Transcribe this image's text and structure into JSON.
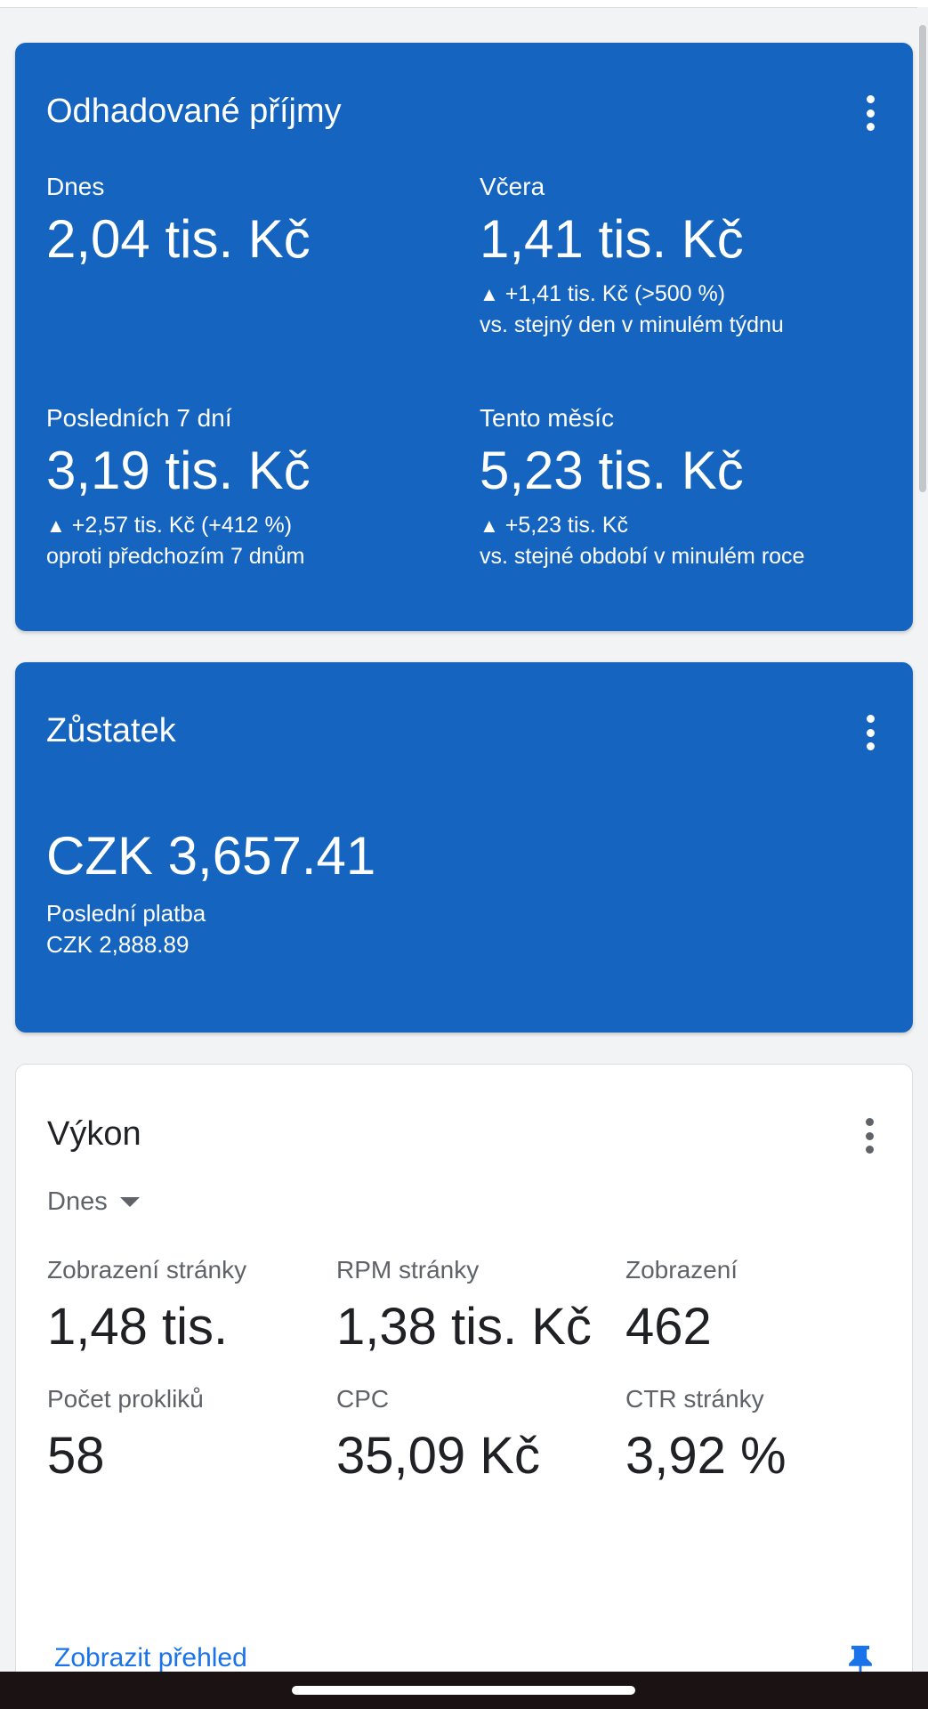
{
  "earnings": {
    "title": "Odhadované příjmy",
    "today": {
      "label": "Dnes",
      "value": "2,04 tis. Kč"
    },
    "yesterday": {
      "label": "Včera",
      "value": "1,41 tis. Kč",
      "delta": "+1,41 tis. Kč (>500 %)",
      "compare": "vs. stejný den v minulém týdnu"
    },
    "last7": {
      "label": "Posledních 7 dní",
      "value": "3,19 tis. Kč",
      "delta": "+2,57 tis. Kč (+412 %)",
      "compare": "oproti předchozím 7 dnům"
    },
    "month": {
      "label": "Tento měsíc",
      "value": "5,23 tis. Kč",
      "delta": "+5,23 tis. Kč",
      "compare": "vs. stejné období v minulém roce"
    },
    "up_glyph": "▲"
  },
  "balance": {
    "title": "Zůstatek",
    "value": "CZK 3,657.41",
    "last_payment_label": "Poslední platba",
    "last_payment_value": "CZK 2,888.89"
  },
  "performance": {
    "title": "Výkon",
    "period": "Dnes",
    "metrics": [
      {
        "label": "Zobrazení stránky",
        "value": "1,48 tis."
      },
      {
        "label": "RPM stránky",
        "value": "1,38 tis. Kč"
      },
      {
        "label": "Zobrazení",
        "value": "462"
      },
      {
        "label": "Počet prokliků",
        "value": "58"
      },
      {
        "label": "CPC",
        "value": "35,09 Kč"
      },
      {
        "label": "CTR stránky",
        "value": "3,92 %"
      }
    ],
    "link": "Zobrazit přehled"
  },
  "icons": {
    "more": "more-vert-icon",
    "dropdown": "arrow-drop-down-icon",
    "pin": "pin-icon"
  },
  "colors": {
    "card_blue": "#1565c0",
    "link_blue": "#1a73e8",
    "pin_blue": "#1a73e8"
  }
}
